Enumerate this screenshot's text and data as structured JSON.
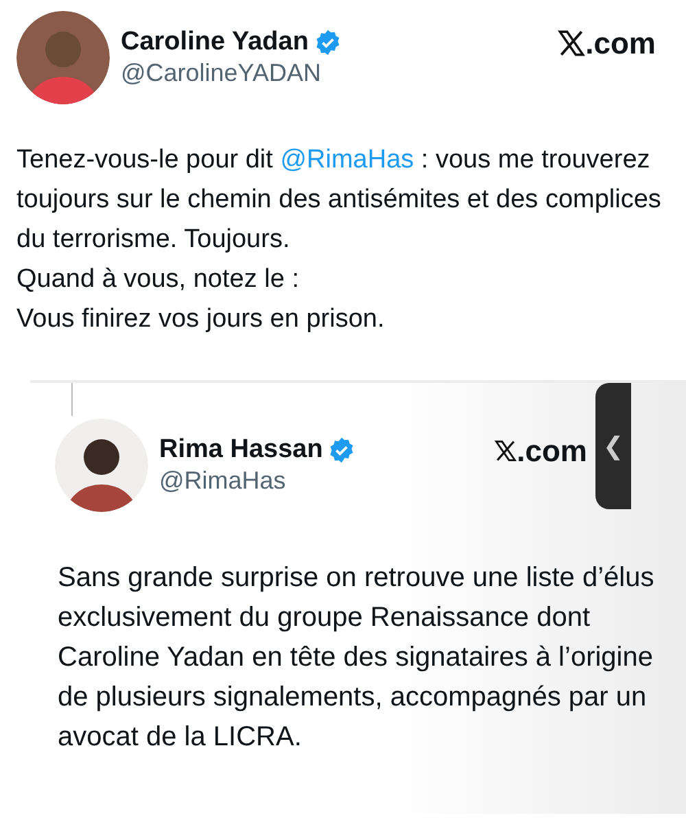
{
  "post": {
    "author": {
      "name": "Caroline Yadan",
      "handle": "@CarolineYADAN",
      "verified": true
    },
    "site": ".com",
    "paragraphs": [
      [
        {
          "kind": "text",
          "text": "Tenez-vous-le pour dit "
        },
        {
          "kind": "mention",
          "text": "@RimaHas"
        },
        {
          "kind": "text",
          "text": " : vous me trouverez toujours sur le chemin des antisémites et des complices du terrorisme. Toujours."
        }
      ],
      [
        {
          "kind": "text",
          "text": "Quand à vous, notez le :"
        }
      ],
      [
        {
          "kind": "text",
          "text": "Vous finirez vos jours en prison."
        }
      ]
    ]
  },
  "quoted_post": {
    "author": {
      "name": "Rima Hassan",
      "handle": "@RimaHas",
      "verified": true
    },
    "site": ".com",
    "text": "Sans grande surprise on retrouve une liste d’élus exclusivement du groupe Renaissance dont Caroline Yadan en tête des signataires à l’origine de plusieurs signalements, accompagnés par un avocat de la LICRA."
  },
  "side_handle": {
    "glyph": "❮"
  }
}
